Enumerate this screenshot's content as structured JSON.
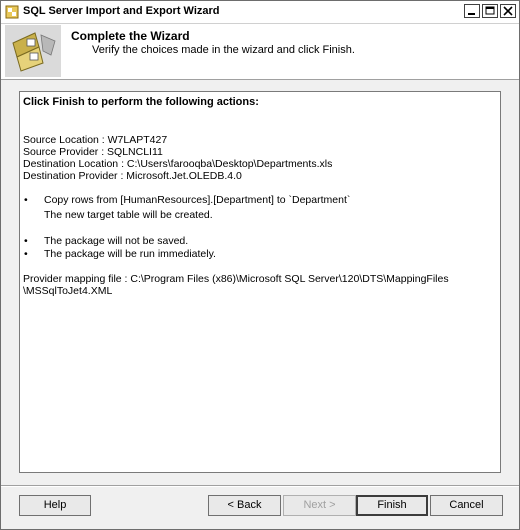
{
  "window": {
    "title": "SQL Server Import and Export Wizard"
  },
  "header": {
    "title": "Complete the Wizard",
    "subtitle": "Verify the choices made in the wizard and click Finish."
  },
  "summary": {
    "heading": "Click Finish to perform the following actions:",
    "source_location": "Source Location : W7LAPT427",
    "source_provider": "Source Provider : SQLNCLI11",
    "destination_location": "Destination Location : C:\\Users\\farooqba\\Desktop\\Departments.xls",
    "destination_provider": "Destination Provider : Microsoft.Jet.OLEDB.4.0",
    "bullet": "•",
    "action_copy": "Copy rows from [HumanResources].[Department] to `Department`",
    "action_copy_note": "The new target table will be created.",
    "action_not_saved": "The package will not be saved.",
    "action_run": "The package will be run immediately.",
    "mapping_line1": "Provider mapping file : C:\\Program Files (x86)\\Microsoft SQL Server\\120\\DTS\\MappingFiles",
    "mapping_line2": "\\MSSqlToJet4.XML"
  },
  "buttons": {
    "help": "Help",
    "back": "< Back",
    "next": "Next >",
    "finish": "Finish",
    "cancel": "Cancel"
  }
}
